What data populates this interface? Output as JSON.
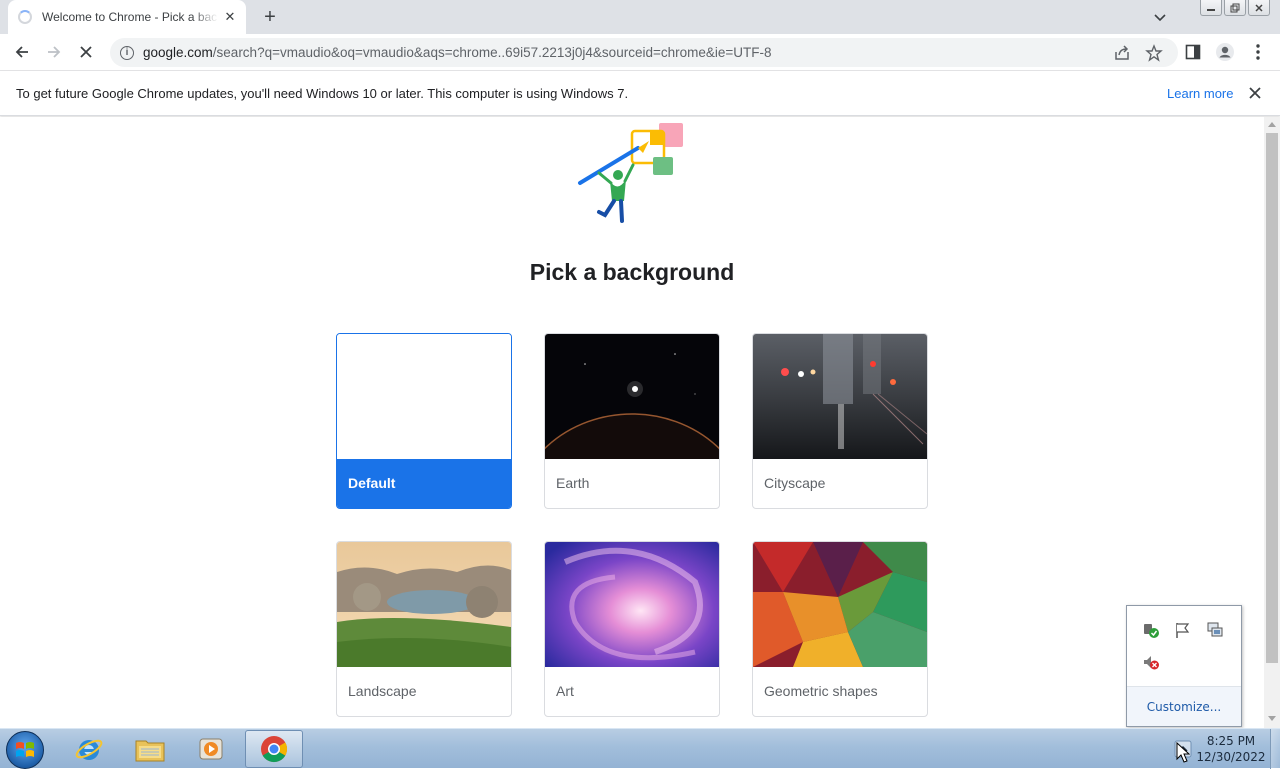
{
  "tab": {
    "title": "Welcome to Chrome - Pick a background",
    "close_glyph": "✕"
  },
  "toolbar": {
    "url_host": "google.com",
    "url_path": "/search?q=vmaudio&oq=vmaudio&aqs=chrome..69i57.2213j0j4&sourceid=chrome&ie=UTF-8",
    "info_glyph": "i"
  },
  "infobar": {
    "message": "To get future Google Chrome updates, you'll need Windows 10 or later. This computer is using Windows 7.",
    "learn_more": "Learn more"
  },
  "page": {
    "heading": "Pick a background",
    "backgrounds": [
      {
        "label": "Default",
        "selected": true
      },
      {
        "label": "Earth",
        "selected": false
      },
      {
        "label": "Cityscape",
        "selected": false
      },
      {
        "label": "Landscape",
        "selected": false
      },
      {
        "label": "Art",
        "selected": false
      },
      {
        "label": "Geometric shapes",
        "selected": false
      }
    ]
  },
  "tray_popup": {
    "icons": [
      "safely-remove-hardware-icon",
      "action-center-flag-icon",
      "network-icon",
      "volume-muted-icon"
    ],
    "customize_label": "Customize..."
  },
  "taskbar": {
    "apps": [
      "start-button",
      "internet-explorer",
      "windows-explorer",
      "media-player",
      "google-chrome"
    ],
    "time": "8:25 PM",
    "date": "12/30/2022"
  },
  "colors": {
    "accent": "#1a73e8",
    "tabstrip": "#dee1e6",
    "taskbar": "#a2bedb"
  }
}
